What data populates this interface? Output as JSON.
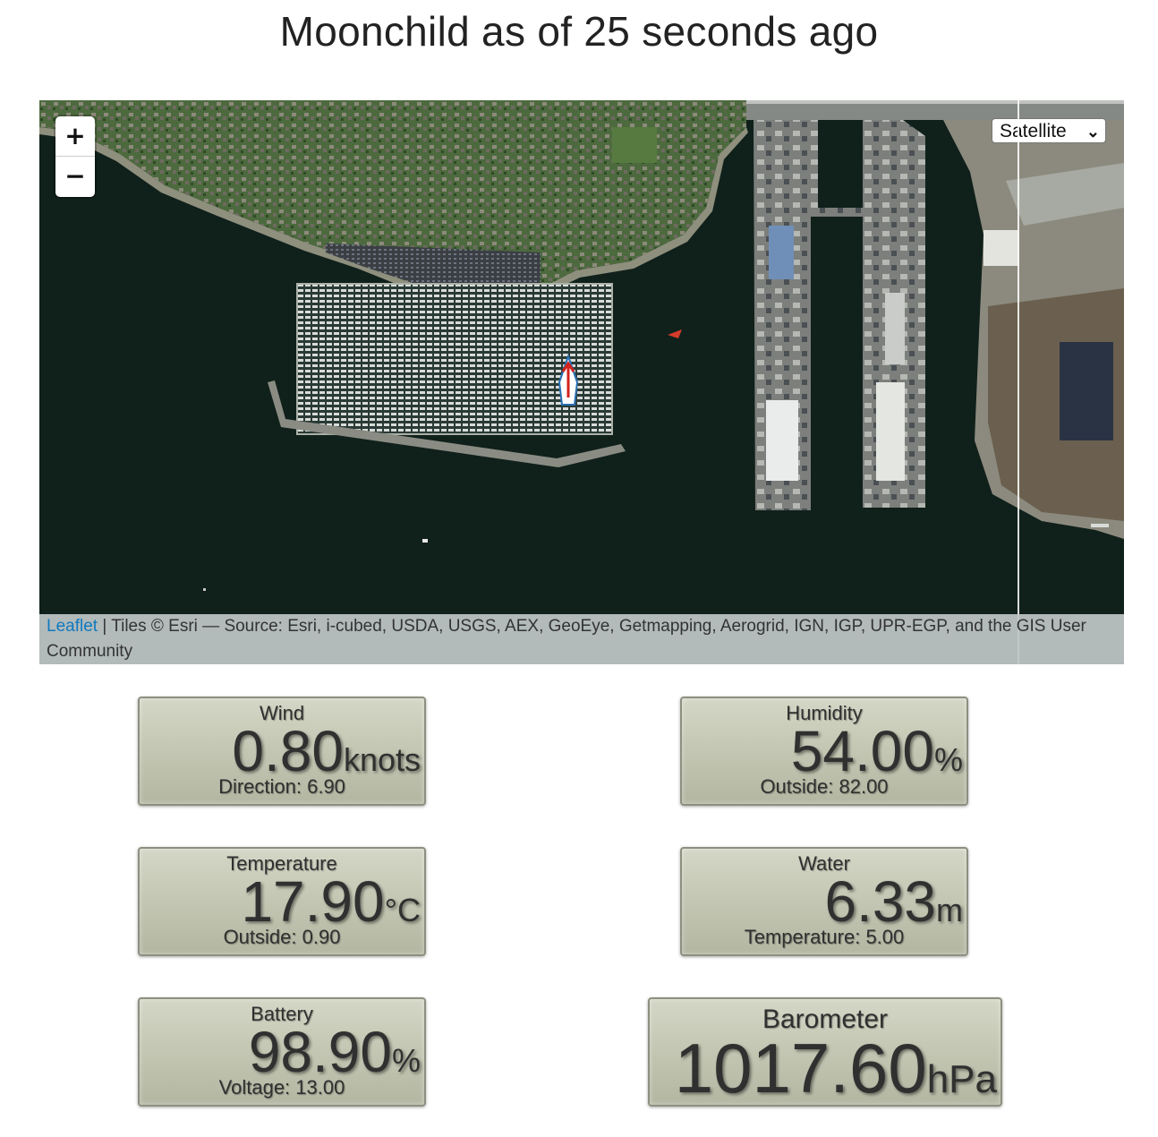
{
  "page": {
    "title": "Moonchild as of 25 seconds ago"
  },
  "map": {
    "zoom_in_label": "+",
    "zoom_out_label": "−",
    "layer_selected": "Satellite",
    "attribution": {
      "leaflet_link": "Leaflet",
      "text": " | Tiles © Esri — Source: Esri, i-cubed, USDA, USGS, AEX, GeoEye, Getmapping, Aerogrid, IGN, IGP, UPR-EGP, and the GIS User Community"
    },
    "marker_icon": "sailboat-icon"
  },
  "gauges": {
    "wind": {
      "label": "Wind",
      "value": "0.80",
      "unit": "knots",
      "sub": "Direction: 6.90"
    },
    "humidity": {
      "label": "Humidity",
      "value": "54.00",
      "unit": "%",
      "sub": "Outside: 82.00"
    },
    "temperature": {
      "label": "Temperature",
      "value": "17.90",
      "unit": "°C",
      "sub": "Outside: 0.90"
    },
    "water": {
      "label": "Water",
      "value": "6.33",
      "unit": "m",
      "sub": "Temperature: 5.00"
    },
    "battery": {
      "label": "Battery",
      "value": "98.90",
      "unit": "%",
      "sub": "Voltage: 13.00"
    },
    "barometer": {
      "label": "Barometer",
      "value": "1017.60",
      "unit": "hPa"
    }
  },
  "colors": {
    "water": "#10201b",
    "land": "#3f5a35",
    "gauge_face": "#c3c6b2",
    "link": "#0f7ac0"
  }
}
